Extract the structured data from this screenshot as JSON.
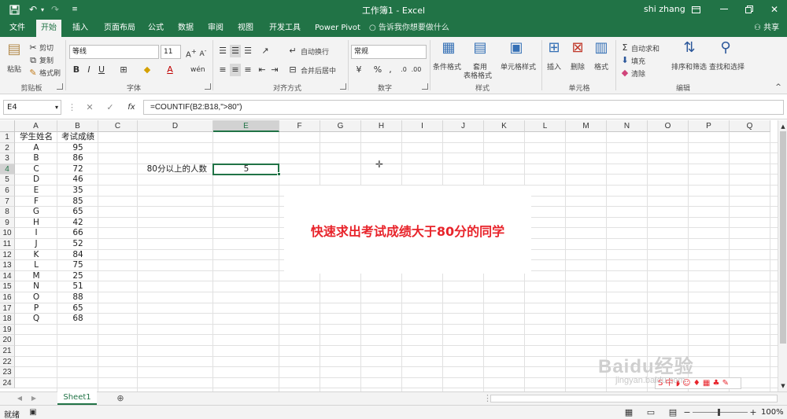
{
  "titlebar": {
    "title": "工作簿1  -  Excel",
    "user": "shi zhang"
  },
  "tabs": [
    {
      "label": "文件"
    },
    {
      "label": "开始"
    },
    {
      "label": "插入"
    },
    {
      "label": "页面布局"
    },
    {
      "label": "公式"
    },
    {
      "label": "数据"
    },
    {
      "label": "审阅"
    },
    {
      "label": "视图"
    },
    {
      "label": "开发工具"
    },
    {
      "label": "Power Pivot"
    }
  ],
  "tellme": "告诉我你想要做什么",
  "share": "共享",
  "ribbon": {
    "paste": "粘贴",
    "cut": "剪切",
    "copy": "复制",
    "format_painter": "格式刷",
    "clipboard_group": "剪贴板",
    "font_name": "等线",
    "font_size": "11",
    "font_group": "字体",
    "wrap_text": "自动换行",
    "merge_center": "合并后居中",
    "alignment_group": "对齐方式",
    "number_format": "常规",
    "number_group": "数字",
    "conditional_format": "条件格式",
    "table_format_1": "套用",
    "table_format_2": "表格格式",
    "cell_styles": "单元格样式",
    "styles_group": "样式",
    "insert": "插入",
    "delete": "删除",
    "format": "格式",
    "cells_group": "单元格",
    "autosum": "自动求和",
    "fill": "填充",
    "clear": "清除",
    "sort_filter": "排序和筛选",
    "find_select": "查找和选择",
    "editing_group": "编辑"
  },
  "formula_bar": {
    "name_box": "E4",
    "formula": "=COUNTIF(B2:B18,\">80\")"
  },
  "columns": [
    "A",
    "B",
    "C",
    "D",
    "E",
    "F",
    "G",
    "H",
    "I",
    "J",
    "K",
    "L",
    "M",
    "N",
    "O",
    "P",
    "Q"
  ],
  "rows": [
    "1",
    "2",
    "3",
    "4",
    "5",
    "6",
    "7",
    "8",
    "9",
    "10",
    "11",
    "12",
    "13",
    "14",
    "15",
    "16",
    "17",
    "18",
    "19",
    "20",
    "21",
    "22",
    "23",
    "24"
  ],
  "table": {
    "headers": [
      "学生姓名",
      "考试成绩"
    ],
    "students": [
      {
        "name": "A",
        "score": "95"
      },
      {
        "name": "B",
        "score": "86"
      },
      {
        "name": "C",
        "score": "72"
      },
      {
        "name": "D",
        "score": "46"
      },
      {
        "name": "E",
        "score": "35"
      },
      {
        "name": "F",
        "score": "85"
      },
      {
        "name": "G",
        "score": "65"
      },
      {
        "name": "H",
        "score": "42"
      },
      {
        "name": "I",
        "score": "66"
      },
      {
        "name": "J",
        "score": "52"
      },
      {
        "name": "K",
        "score": "84"
      },
      {
        "name": "L",
        "score": "75"
      },
      {
        "name": "M",
        "score": "25"
      },
      {
        "name": "N",
        "score": "51"
      },
      {
        "name": "O",
        "score": "88"
      },
      {
        "name": "P",
        "score": "65"
      },
      {
        "name": "Q",
        "score": "68"
      }
    ]
  },
  "d4_label": "80分以上的人数",
  "e4_value": "5",
  "annotation": "快速求出考试成绩大于80分的同学",
  "sheet_tab": "Sheet1",
  "status": {
    "ready": "就绪",
    "zoom": "100%"
  },
  "watermark": {
    "brand": "Baidu经验",
    "url": "jingyan.baidu.com",
    "ime": "S 中 ◗ ☺ ♦ ▦ ♣ ✎"
  },
  "colors": {
    "excel_green": "#217346",
    "annotation_red": "#e8242b"
  }
}
